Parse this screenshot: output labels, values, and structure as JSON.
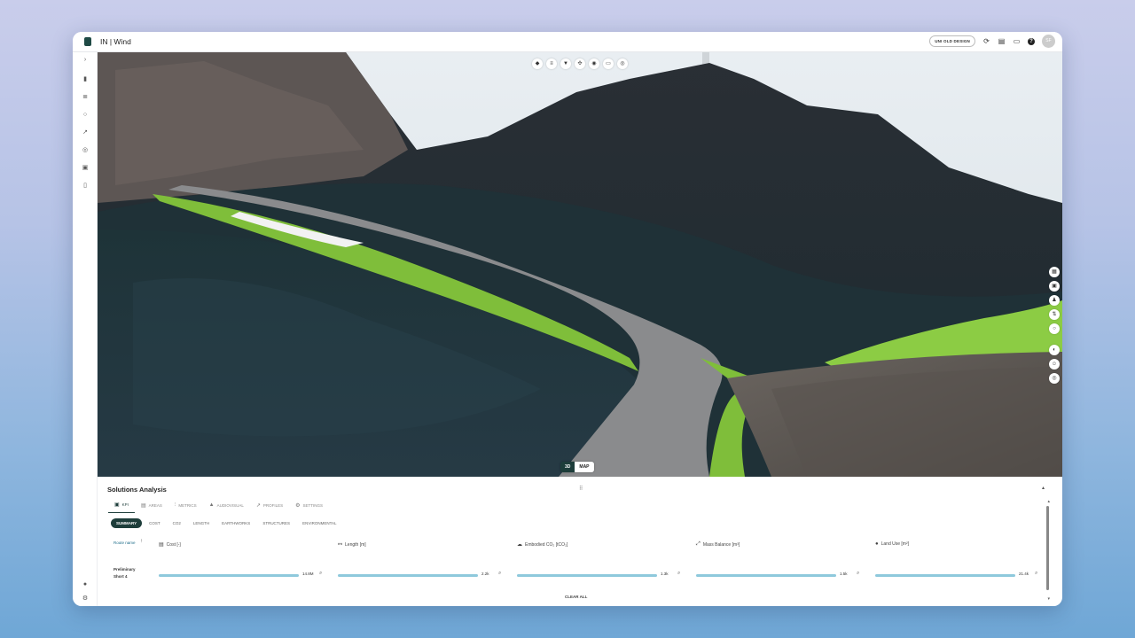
{
  "window": {
    "title": "IN | Wind"
  },
  "titlebar": {
    "old_design_label": "UNI OLD DESIGN",
    "icons": [
      "refresh-icon",
      "document-icon",
      "comment-icon",
      "help-icon"
    ],
    "avatar_initials": "SF"
  },
  "sidebar": {
    "icons": [
      "chevron-right-icon",
      "chart-icon",
      "bar-layers-icon",
      "circle-icon",
      "route-icon",
      "target-icon",
      "frame-icon",
      "file-icon",
      "globe-icon",
      "gear-icon"
    ]
  },
  "viewport": {
    "toolbar_icons": [
      "layers-icon",
      "sliders-icon",
      "filter-icon",
      "move-icon",
      "camera-icon",
      "ruler-icon",
      "eye-icon"
    ],
    "right_tools": [
      "grid-icon",
      "save-icon",
      "person-icon",
      "layers-swap-icon",
      "circle-icon",
      "compass-icon",
      "user-icon",
      "target-icon"
    ],
    "toggle": {
      "option_3d": "3D",
      "option_map": "MAP",
      "selected": "3D"
    }
  },
  "panel": {
    "title": "Solutions Analysis",
    "tabs": [
      {
        "label": "KPI",
        "icon": "kpi-icon",
        "active": true
      },
      {
        "label": "AREAS",
        "icon": "areas-icon",
        "active": false
      },
      {
        "label": "METRICS",
        "icon": "metrics-icon",
        "active": false
      },
      {
        "label": "AUDIOVISUAL",
        "icon": "audiovisual-icon",
        "active": false
      },
      {
        "label": "PROFILES",
        "icon": "profiles-icon",
        "active": false
      },
      {
        "label": "SETTINGS",
        "icon": "settings-icon",
        "active": false
      }
    ],
    "chips": [
      "SUMMARY",
      "COST",
      "CO2",
      "LENGTH",
      "EARTHWORKS",
      "STRUCTURES",
      "ENVIRONMENTAL"
    ],
    "active_chip": "SUMMARY",
    "table": {
      "route_header": "Route name",
      "metric_headers": [
        "Cost [-]",
        "Length [m]",
        "Embodied CO₂ [tCO₂]",
        "Mass Balance [m³]",
        "Land Use [m²]"
      ],
      "rows": [
        {
          "name": "Preliminary Short 4",
          "values": [
            "14.8M",
            "2.2k",
            "1.3k",
            "1.5k",
            "21.4k"
          ]
        }
      ]
    },
    "clear_all_label": "CLEAR ALL"
  }
}
